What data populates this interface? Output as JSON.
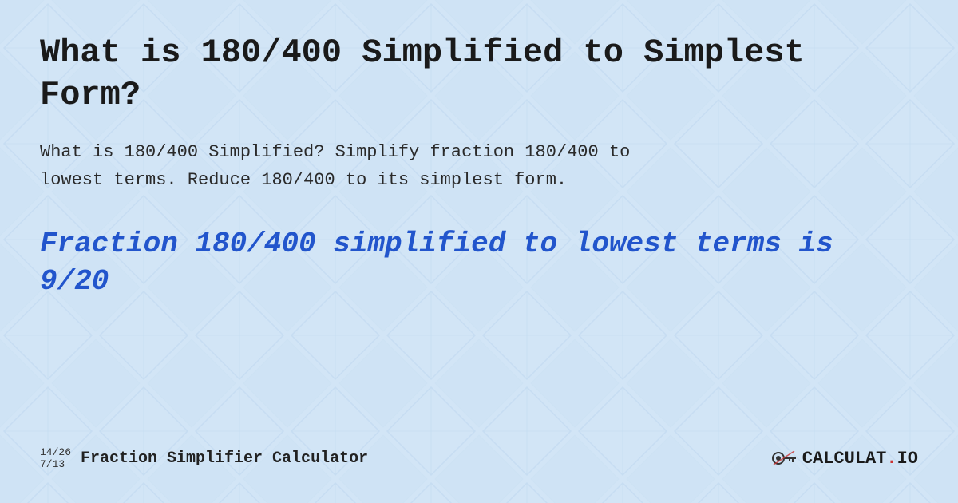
{
  "page": {
    "title": "What is 180/400 Simplified to Simplest Form?",
    "description_line1": "What is 180/400 Simplified? Simplify fraction 180/400 to",
    "description_line2": "lowest terms. Reduce 180/400 to its simplest form.",
    "result": "Fraction 180/400 simplified to lowest terms is 9/20",
    "footer": {
      "fraction_top": "14/26",
      "fraction_bottom": "7/13",
      "site_title": "Fraction Simplifier Calculator",
      "logo_text": "CALCULAT.IO"
    }
  },
  "colors": {
    "background": "#cfe3f5",
    "title_color": "#1a1a1a",
    "result_color": "#2255cc",
    "text_color": "#2a2a2a"
  }
}
